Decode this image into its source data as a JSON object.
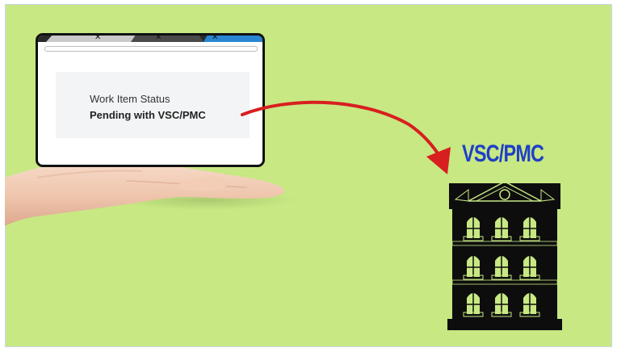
{
  "browser": {
    "close_glyph": "✕",
    "card": {
      "status_label": "Work Item Status",
      "status_value": "Pending with VSC/PMC"
    }
  },
  "destination": {
    "label": "VSC/PMC"
  },
  "colors": {
    "background": "#c7e883",
    "arrow": "#d81f1f",
    "label": "#1f3fc8",
    "building": "#0d0d0d",
    "windows": "#c7e883"
  },
  "icons": [
    "hand-illustration",
    "curved-arrow-icon",
    "building-icon",
    "close-icon"
  ]
}
